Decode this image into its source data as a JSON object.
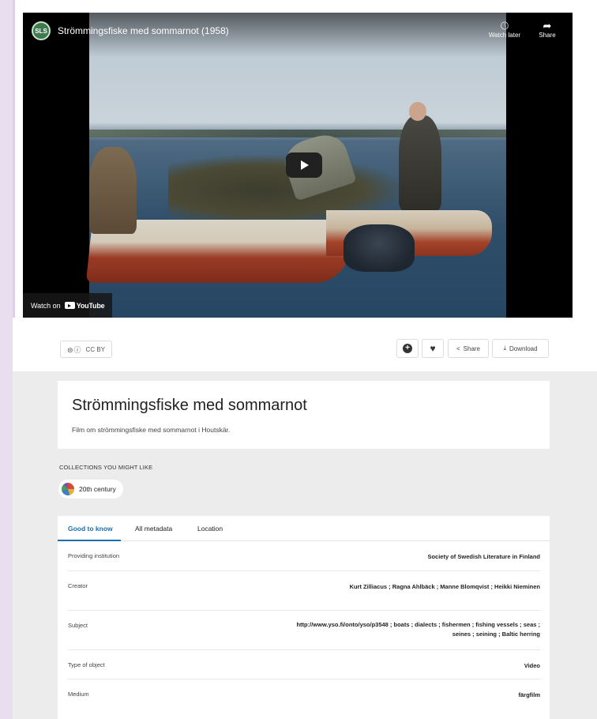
{
  "video": {
    "title": "Strömmingsfiske med sommarnot (1958)",
    "channel_logo_text": "SLS",
    "watch_later_label": "Watch later",
    "share_label": "Share",
    "watch_on_label": "Watch on",
    "youtube_label": "YouTube"
  },
  "toolbar": {
    "license_label": "CC BY",
    "license_icons": "⊜ⓘ",
    "share_label": "Share",
    "download_label": "Download"
  },
  "item": {
    "title": "Strömmingsfiske med sommarnot",
    "description": "Film om strömmingsfiske med sommarnot i Houtskär."
  },
  "collections": {
    "heading": "COLLECTIONS YOU MIGHT LIKE",
    "chips": [
      {
        "label": "20th century"
      }
    ]
  },
  "tabs": [
    {
      "label": "Good to know",
      "active": true
    },
    {
      "label": "All metadata",
      "active": false
    },
    {
      "label": "Location",
      "active": false
    }
  ],
  "metadata": [
    {
      "key": "Providing institution",
      "value": "Society of Swedish Literature in Finland"
    },
    {
      "key": "Creator",
      "value": "Kurt Zilliacus ; Ragna Ahlbäck ; Manne Blomqvist ; Heikki Nieminen"
    },
    {
      "key": "Subject",
      "value": "http://www.yso.fi/onto/yso/p3548 ; boats ; dialects ; fishermen ; fishing vessels ; seas ; seines ; seining ; Baltic herring"
    },
    {
      "key": "Type of object",
      "value": "Video"
    },
    {
      "key": "Medium",
      "value": "färgfilm"
    }
  ],
  "colors": {
    "accent": "#1a6fb0",
    "page_bg": "#ececec",
    "frame_border": "#dccfe6"
  }
}
